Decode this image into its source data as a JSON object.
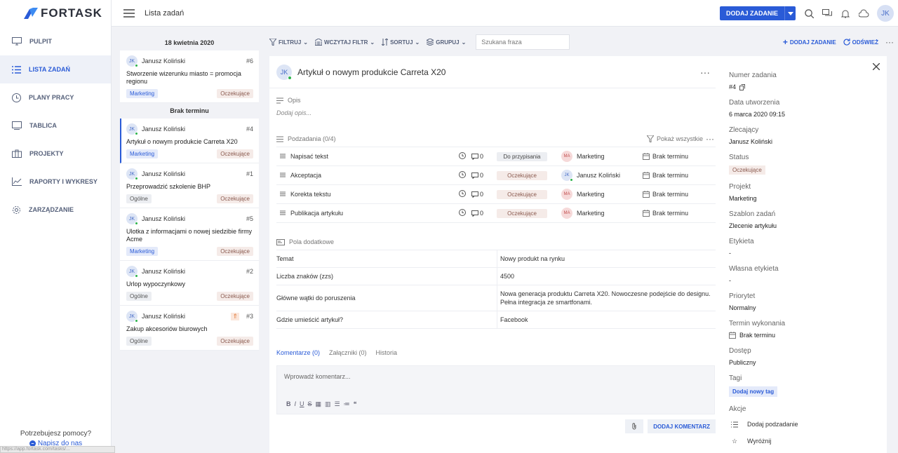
{
  "app": {
    "logo_text": "FORTASK",
    "brand_color": "#2a5bd7"
  },
  "sidebar": {
    "items": [
      {
        "label": "PULPIT",
        "icon": "monitor-icon"
      },
      {
        "label": "LISTA ZADAŃ",
        "icon": "list-icon",
        "active": true
      },
      {
        "label": "PLANY PRACY",
        "icon": "clock-icon"
      },
      {
        "label": "TABLICA",
        "icon": "board-icon"
      },
      {
        "label": "PROJEKTY",
        "icon": "briefcase-icon"
      },
      {
        "label": "RAPORTY I WYKRESY",
        "icon": "chart-icon"
      },
      {
        "label": "ZARZĄDZANIE",
        "icon": "gear-icon"
      }
    ],
    "help_text": "Potrzebujesz pomocy?",
    "help_link": "Napisz do nas"
  },
  "topbar": {
    "title": "Lista zadań",
    "add_task": "DODAJ ZADANIE",
    "avatar": "JK"
  },
  "filters": {
    "filter": "FILTRUJ",
    "load_filter": "WCZYTAJ FILTR",
    "sort": "SORTUJ",
    "group": "GRUPUJ",
    "search_placeholder": "Szukana fraza",
    "add_task": "DODAJ ZADANIE",
    "refresh": "ODŚWIEŻ"
  },
  "groups": [
    {
      "title": "18 kwietnia 2020",
      "cards": [
        {
          "av": "JK",
          "name": "Janusz Koliński",
          "num": "#6",
          "text": "Stworzenie wizerunku miasto = promocja regionu",
          "tag": "Marketing",
          "tag_type": "mk",
          "status": "Oczekujące"
        }
      ]
    },
    {
      "title": "Brak terminu",
      "cards": [
        {
          "av": "JK",
          "name": "Janusz Koliński",
          "num": "#4",
          "text": "Artykuł o nowym produkcie Carreta X20",
          "tag": "Marketing",
          "tag_type": "mk",
          "status": "Oczekujące",
          "selected": true
        },
        {
          "av": "JK",
          "name": "Janusz Koliński",
          "num": "#1",
          "text": "Przeprowadzić szkolenie BHP",
          "tag": "Ogólne",
          "tag_type": "og",
          "status": "Oczekujące"
        },
        {
          "av": "JK",
          "name": "Janusz Koliński",
          "num": "#5",
          "text": "Ulotka z informacjami o nowej siedzibie firmy Acme",
          "tag": "Marketing",
          "tag_type": "mk",
          "status": "Oczekujące"
        },
        {
          "av": "JK",
          "name": "Janusz Koliński",
          "num": "#2",
          "text": "Urlop wypoczynkowy",
          "tag": "Ogólne",
          "tag_type": "og",
          "status": "Oczekujące"
        },
        {
          "av": "JK",
          "name": "Janusz Koliński",
          "num": "#3",
          "text": "Zakup akcesoriów biurowych",
          "tag": "Ogólne",
          "tag_type": "og",
          "status": "Oczekujące",
          "priority": true
        }
      ]
    }
  ],
  "task": {
    "avatar": "JK",
    "title": "Artykuł o nowym produkcie Carreta X20",
    "desc_label": "Opis",
    "desc_placeholder": "Dodaj opis...",
    "subtasks_label": "Podzadania (0/4)",
    "show_all": "Pokaż wszystkie",
    "subtasks": [
      {
        "name": "Napisać tekst",
        "comments": "0",
        "status": "Do przypisania",
        "st_type": "dp",
        "asg_av": "MA",
        "asg_type": "ma",
        "assignee": "Marketing",
        "term": "Brak terminu"
      },
      {
        "name": "Akceptacja",
        "comments": "0",
        "status": "Oczekujące",
        "st_type": "oc",
        "asg_av": "JK",
        "asg_type": "jk",
        "assignee": "Janusz Koliński",
        "term": "Brak terminu"
      },
      {
        "name": "Korekta tekstu",
        "comments": "0",
        "status": "Oczekujące",
        "st_type": "oc",
        "asg_av": "MA",
        "asg_type": "ma",
        "assignee": "Marketing",
        "term": "Brak terminu"
      },
      {
        "name": "Publikacja artykułu",
        "comments": "0",
        "status": "Oczekujące",
        "st_type": "oc",
        "asg_av": "MA",
        "asg_type": "ma",
        "assignee": "Marketing",
        "term": "Brak terminu"
      }
    ],
    "fields_label": "Pola dodatkowe",
    "fields": [
      {
        "k": "Temat",
        "v": "Nowy produkt na rynku"
      },
      {
        "k": "Liczba znaków (zzs)",
        "v": "4500"
      },
      {
        "k": "Główne wątki do poruszenia",
        "v": "Nowa generacja produktu  Carreta X20. Nowoczesne podejście do designu. Pełna integracja ze smartfonami."
      },
      {
        "k": "Gdzie umieścić artykuł?",
        "v": "Facebook"
      }
    ],
    "tabs": [
      "Komentarze (0)",
      "Załączniki (0)",
      "Historia"
    ],
    "comment_placeholder": "Wprowadź komentarz...",
    "add_comment": "DODAJ KOMENTARZ"
  },
  "details": {
    "num_label": "Numer zadania",
    "num": "#4",
    "created_label": "Data utworzenia",
    "created": "6 marca 2020 09:15",
    "client_label": "Zlecający",
    "client": "Janusz Koliński",
    "status_label": "Status",
    "status": "Oczekujące",
    "project_label": "Projekt",
    "project": "Marketing",
    "template_label": "Szablon zadań",
    "template": "Zlecenie artykułu",
    "tag_label": "Etykieta",
    "tag": "-",
    "own_tag_label": "Własna etykieta",
    "own_tag": "-",
    "priority_label": "Priorytet",
    "priority": "Normalny",
    "due_label": "Termin wykonania",
    "due": "Brak terminu",
    "access_label": "Dostęp",
    "access": "Publiczny",
    "tags_label": "Tagi",
    "add_tag": "Dodaj nowy tag",
    "actions_label": "Akcje",
    "action1": "Dodaj podzadanie",
    "action2": "Wyróżnij"
  },
  "statusbar": "https://app.fortask.com/tasks/..."
}
